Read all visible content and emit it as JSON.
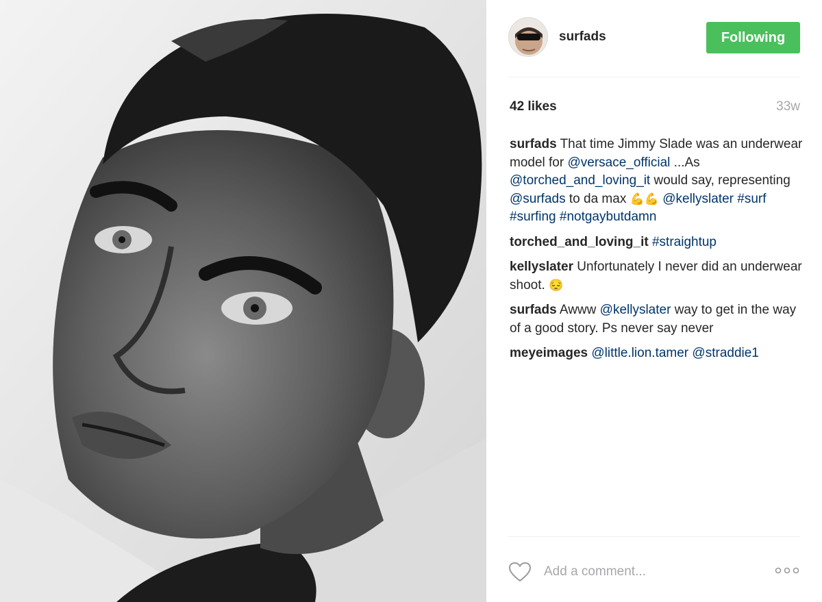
{
  "post": {
    "photo_icon": "portrait-photo",
    "username": "surfads",
    "follow_label": "Following",
    "likes": "42 likes",
    "time": "33w",
    "add_comment_placeholder": "Add a comment...",
    "colors": {
      "follow_bg": "#4ac05c",
      "link": "#003569",
      "muted": "#a5a7aa"
    }
  },
  "comments": [
    {
      "user": "surfads",
      "parts": [
        {
          "t": "text",
          "v": "That time Jimmy Slade was an underwear model for "
        },
        {
          "t": "tag",
          "v": "@versace_official"
        },
        {
          "t": "text",
          "v": " ...As "
        },
        {
          "t": "tag",
          "v": "@torched_and_loving_it"
        },
        {
          "t": "text",
          "v": " would say, representing "
        },
        {
          "t": "tag",
          "v": "@surfads"
        },
        {
          "t": "text",
          "v": " to da max "
        },
        {
          "t": "emoji",
          "v": "💪💪"
        },
        {
          "t": "text",
          "v": " "
        },
        {
          "t": "tag",
          "v": "@kellyslater"
        },
        {
          "t": "text",
          "v": " "
        },
        {
          "t": "tag",
          "v": "#surf"
        },
        {
          "t": "text",
          "v": " "
        },
        {
          "t": "tag",
          "v": "#surfing"
        },
        {
          "t": "text",
          "v": " "
        },
        {
          "t": "tag",
          "v": "#notgaybutdamn"
        }
      ]
    },
    {
      "user": "torched_and_loving_it",
      "parts": [
        {
          "t": "tag",
          "v": "#straightup"
        }
      ]
    },
    {
      "user": "kellyslater",
      "parts": [
        {
          "t": "text",
          "v": "Unfortunately I never did an underwear shoot. "
        },
        {
          "t": "emoji",
          "v": "😔"
        }
      ]
    },
    {
      "user": "surfads",
      "parts": [
        {
          "t": "text",
          "v": "Awww "
        },
        {
          "t": "tag",
          "v": "@kellyslater"
        },
        {
          "t": "text",
          "v": " way to get in the way of a good story. Ps never say never"
        }
      ]
    },
    {
      "user": "meyeimages",
      "parts": [
        {
          "t": "tag",
          "v": "@little.lion.tamer"
        },
        {
          "t": "text",
          "v": " "
        },
        {
          "t": "tag",
          "v": "@straddie1"
        }
      ]
    }
  ]
}
